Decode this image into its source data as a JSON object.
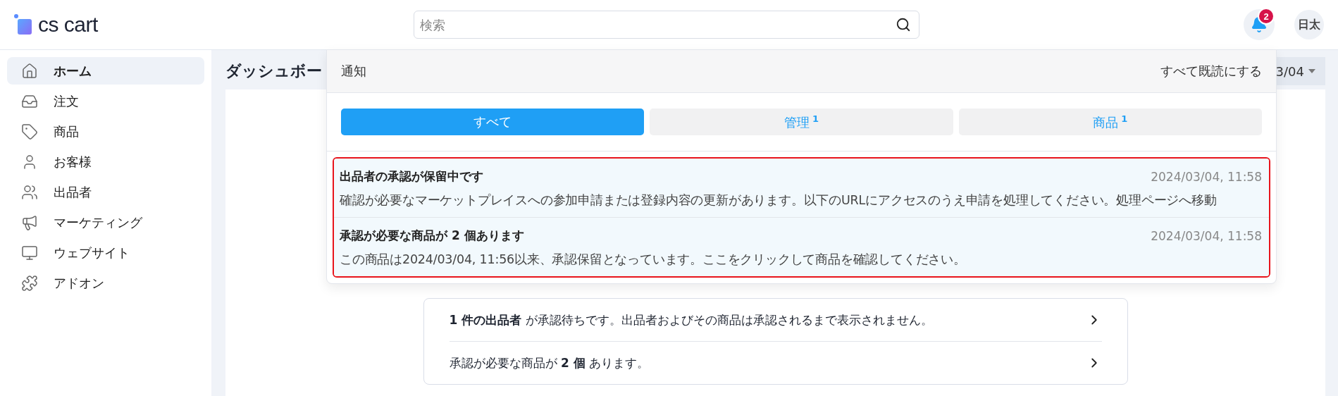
{
  "header": {
    "logo": "cs cart",
    "search": {
      "placeholder": "検索"
    },
    "notifications_badge": "2",
    "avatar": "日太"
  },
  "sidebar": {
    "items": [
      {
        "label": "ホーム",
        "selected": true
      },
      {
        "label": "注文",
        "selected": false
      },
      {
        "label": "商品",
        "selected": false
      },
      {
        "label": "お客様",
        "selected": false
      },
      {
        "label": "出品者",
        "selected": false
      },
      {
        "label": "マーケティング",
        "selected": false
      },
      {
        "label": "ウェブサイト",
        "selected": false
      },
      {
        "label": "アドオン",
        "selected": false
      }
    ]
  },
  "page": {
    "title": "ダッシュボー",
    "date_picker": "3/04"
  },
  "notifications": {
    "title": "通知",
    "mark_all_read": "すべて既読にする",
    "tabs": [
      {
        "label": "すべて",
        "selected": true
      },
      {
        "label": "管理",
        "count": "1",
        "selected": false
      },
      {
        "label": "商品",
        "count": "1",
        "selected": false
      }
    ],
    "items": [
      {
        "title": "出品者の承認が保留中です",
        "time": "2024/03/04, 11:58",
        "body": "確認が必要なマーケットプレイスへの参加申請または登録内容の更新があります。以下のURLにアクセスのうえ申請を処理してください。処理ページへ移動",
        "unread": true
      },
      {
        "title": "承認が必要な商品が 2 個あります",
        "time": "2024/03/04, 11:58",
        "body": "この商品は2024/03/04, 11:56以来、承認保留となっています。ここをクリックして商品を確認してください。",
        "unread": true
      }
    ]
  },
  "alerts": [
    {
      "text": "**1 件の出品者** が承認待ちです。出品者およびその商品は承認されるまで表示されません。"
    },
    {
      "text": "承認が必要な商品が **2 個** あります。"
    }
  ]
}
